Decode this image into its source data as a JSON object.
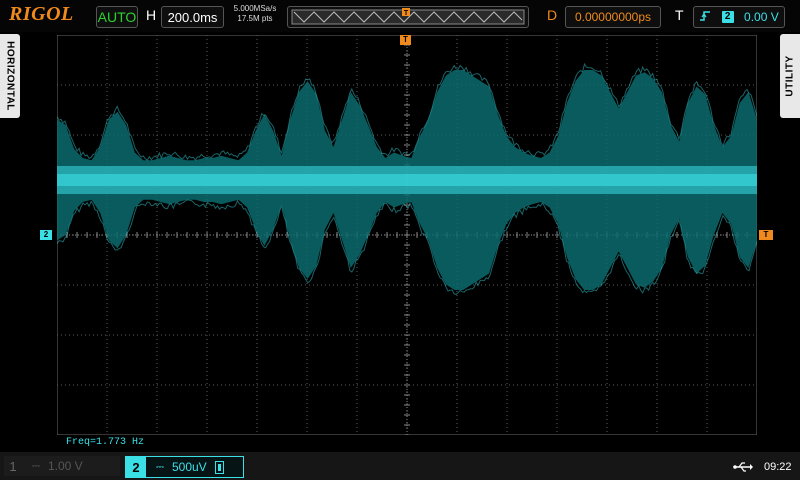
{
  "header": {
    "brand": "RIGOL",
    "run_mode": "AUTO",
    "horizontal_label": "H",
    "timebase": "200.0ms",
    "sample_rate": "5.000MSa/s",
    "memory_depth": "17.5M pts",
    "delay_label": "D",
    "delay": "0.00000000ps",
    "trigger_label": "T",
    "trigger_source": "2",
    "trigger_level": "0.00 V"
  },
  "side_menus": {
    "left": "HORIZONTAL",
    "right": "UTILITY"
  },
  "markers": {
    "channel2": "2",
    "trigger_level": "T",
    "trigger_position": "T"
  },
  "measurement": {
    "freq": "Freq=1.773 Hz"
  },
  "channels": {
    "ch1": {
      "number": "1",
      "scale": "1.00 V",
      "enabled": false
    },
    "ch2": {
      "number": "2",
      "scale": "500uV",
      "enabled": true
    }
  },
  "status": {
    "time": "09:22"
  },
  "colors": {
    "ch2": "#3ae0e6",
    "brand": "#f08a1c",
    "auto": "#2dd12d",
    "grid": "#5a5a5a"
  },
  "icons": {
    "trigger_slope": "rising-edge-icon",
    "ch2_coupling": "dc-coupling-icon",
    "usb": "usb-icon"
  },
  "waveform": {
    "channel": "2",
    "amplitude_envelope": [
      0.55,
      0.5,
      0.28,
      0.2,
      0.18,
      0.3,
      0.55,
      0.62,
      0.5,
      0.25,
      0.18,
      0.18,
      0.2,
      0.22,
      0.2,
      0.18,
      0.18,
      0.2,
      0.2,
      0.22,
      0.2,
      0.18,
      0.25,
      0.45,
      0.6,
      0.45,
      0.22,
      0.55,
      0.8,
      0.9,
      0.78,
      0.45,
      0.3,
      0.55,
      0.8,
      0.68,
      0.5,
      0.3,
      0.2,
      0.25,
      0.22,
      0.2,
      0.4,
      0.55,
      0.8,
      0.95,
      1.0,
      1.0,
      0.95,
      0.9,
      0.85,
      0.6,
      0.4,
      0.3,
      0.25,
      0.22,
      0.2,
      0.25,
      0.4,
      0.7,
      0.9,
      1.0,
      1.0,
      0.95,
      0.8,
      0.65,
      0.8,
      0.95,
      0.98,
      0.92,
      0.8,
      0.5,
      0.35,
      0.7,
      0.85,
      0.78,
      0.5,
      0.3,
      0.4,
      0.7,
      0.8,
      0.55
    ]
  }
}
